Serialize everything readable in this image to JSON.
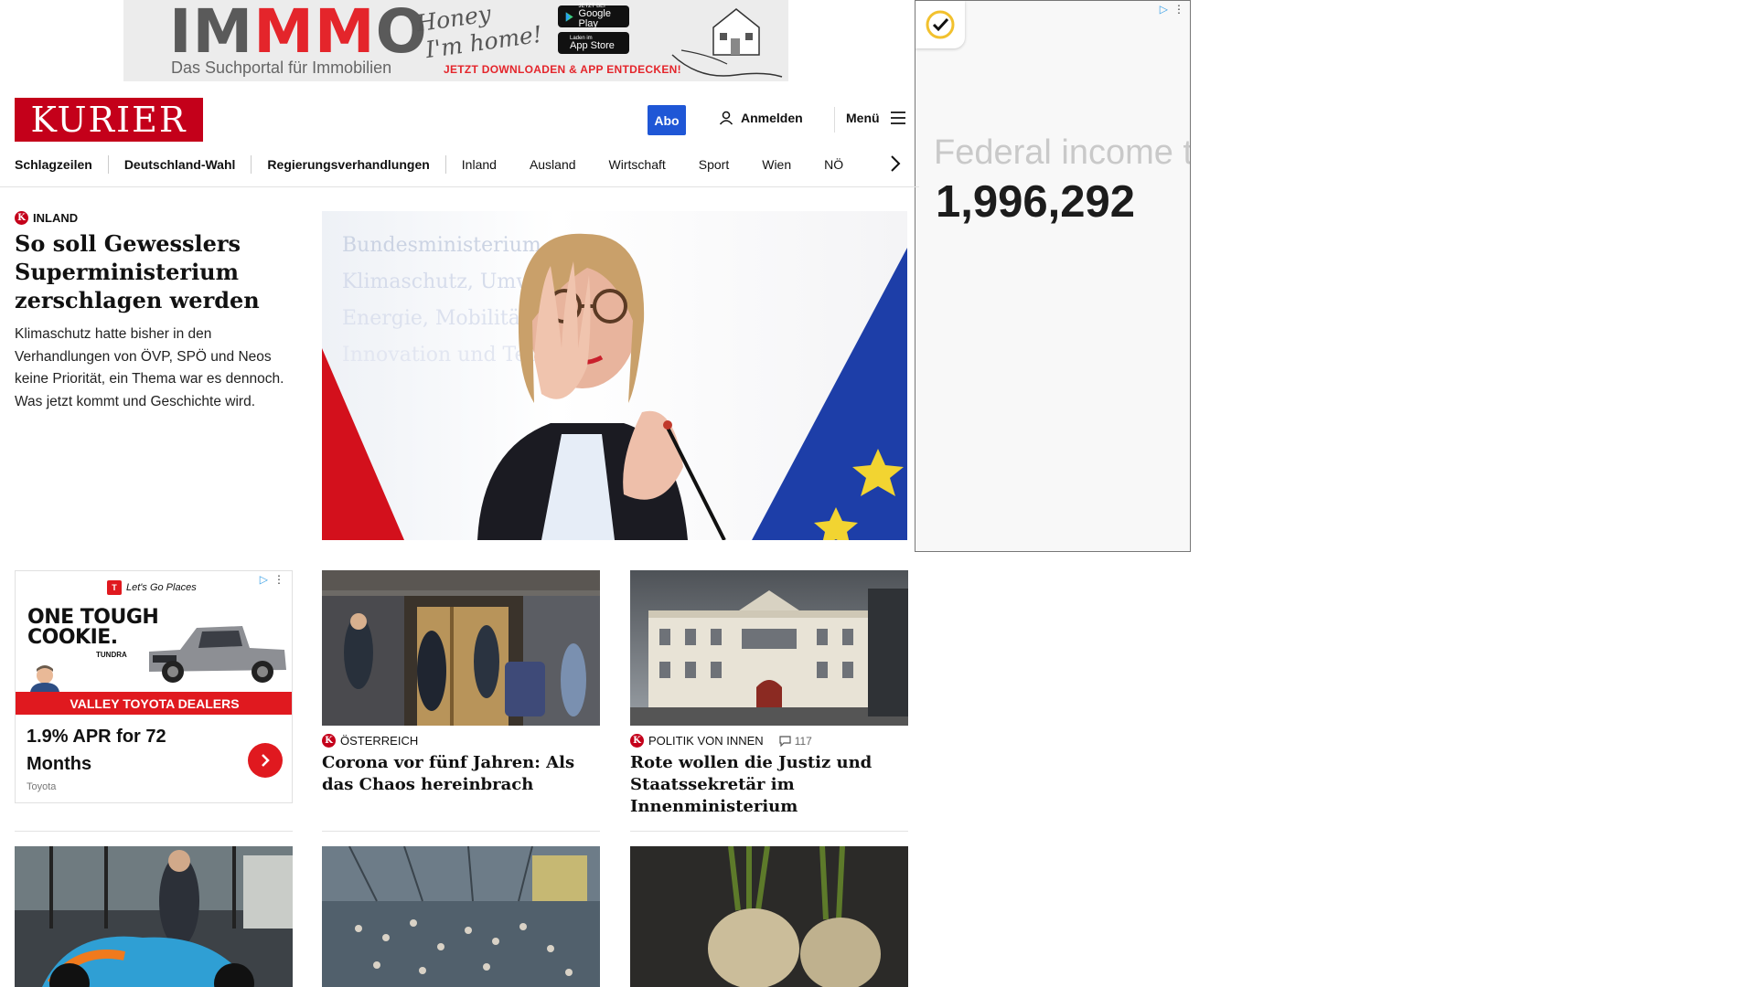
{
  "top_ad": {
    "logo_part1": "IM",
    "logo_part2": "MM",
    "logo_part3": "O",
    "tagline": "Das Suchportal für Immobilien",
    "slogan_line1": "Honey",
    "slogan_line2": "I'm home!",
    "google_play_small": "JETZT BEI",
    "google_play": "Google Play",
    "app_store_small": "Laden im",
    "app_store": "App Store",
    "cta": "JETZT DOWNLOADEN & APP ENTDECKEN!"
  },
  "side_ad": {
    "text": "Federal income t",
    "number": "1,996,292"
  },
  "header": {
    "logo": "KURIER",
    "abo": "Abo",
    "login": "Anmelden",
    "menu": "Menü"
  },
  "nav": {
    "items": [
      "Schlagzeilen",
      "Deutschland-Wahl",
      "Regierungsverhandlungen",
      "Inland",
      "Ausland",
      "Wirtschaft",
      "Sport",
      "Wien",
      "NÖ"
    ]
  },
  "lead": {
    "kicker": "INLAND",
    "title": "So soll Gewesslers Superministerium zerschlagen werden",
    "teaser": "Klimaschutz hatte bisher in den Verhandlungen von ÖVP, SPÖ und Neos keine Priorität, ein Thema war es dennoch. Was jetzt kommt und Geschichte wird."
  },
  "toyota_ad": {
    "brand": "Let's Go Places",
    "headline_1": "ONE TOUGH",
    "headline_2": "COOKIE.",
    "model": "TUNDRA",
    "band": "VALLEY TOYOTA DEALERS",
    "offer": "1.9% APR for 72 Months",
    "advertiser": "Toyota"
  },
  "cards": [
    {
      "kicker": "ÖSTERREICH",
      "title": "Corona vor fünf Jahren: Als das Chaos hereinbrach"
    },
    {
      "kicker": "POLITIK VON INNEN",
      "comments": "117",
      "title": "Rote wollen die Justiz und Staatssekretär im Innenministerium"
    }
  ],
  "colors": {
    "brand_red": "#c4001a",
    "abo_blue": "#1f57d6",
    "toyota_red": "#e0191f"
  }
}
